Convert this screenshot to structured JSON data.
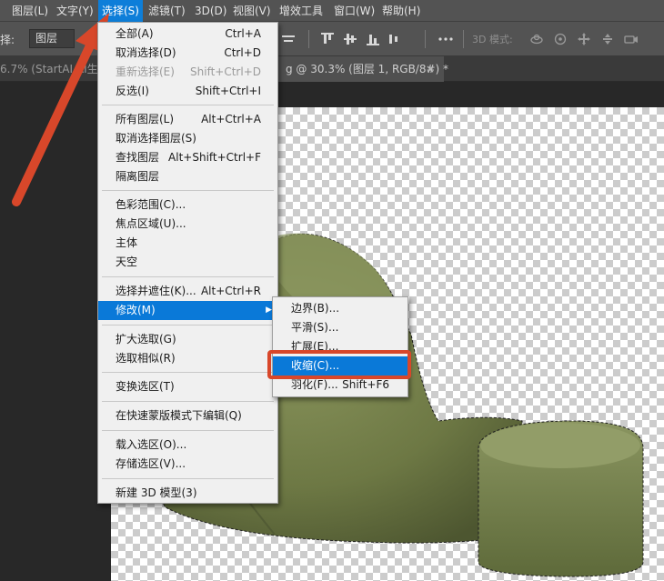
{
  "menubar": {
    "items": [
      "图层(L)",
      "文字(Y)",
      "选择(S)",
      "滤镜(T)",
      "3D(D)",
      "视图(V)",
      "增效工具",
      "窗口(W)",
      "帮助(H)"
    ]
  },
  "options": {
    "label": "择:",
    "layer_select": "图层",
    "mode_3d": "3D 模式:"
  },
  "tabs": {
    "left": "6.7% (StartAI AI生成",
    "current": "g @ 30.3% (图层 1, RGB/8#) *",
    "close": "×"
  },
  "select_menu": {
    "items": [
      {
        "label": "全部(A)",
        "shortcut": "Ctrl+A"
      },
      {
        "label": "取消选择(D)",
        "shortcut": "Ctrl+D"
      },
      {
        "label": "重新选择(E)",
        "shortcut": "Shift+Ctrl+D"
      },
      {
        "label": "反选(I)",
        "shortcut": "Shift+Ctrl+I"
      },
      {
        "label": "所有图层(L)",
        "shortcut": "Alt+Ctrl+A"
      },
      {
        "label": "取消选择图层(S)",
        "shortcut": ""
      },
      {
        "label": "查找图层",
        "shortcut": "Alt+Shift+Ctrl+F"
      },
      {
        "label": "隔离图层",
        "shortcut": ""
      },
      {
        "label": "色彩范围(C)...",
        "shortcut": ""
      },
      {
        "label": "焦点区域(U)...",
        "shortcut": ""
      },
      {
        "label": "主体",
        "shortcut": ""
      },
      {
        "label": "天空",
        "shortcut": ""
      },
      {
        "label": "选择并遮住(K)...",
        "shortcut": "Alt+Ctrl+R"
      },
      {
        "label": "修改(M)",
        "shortcut": ""
      },
      {
        "label": "扩大选取(G)",
        "shortcut": ""
      },
      {
        "label": "选取相似(R)",
        "shortcut": ""
      },
      {
        "label": "变换选区(T)",
        "shortcut": ""
      },
      {
        "label": "在快速蒙版模式下编辑(Q)",
        "shortcut": ""
      },
      {
        "label": "载入选区(O)...",
        "shortcut": ""
      },
      {
        "label": "存储选区(V)...",
        "shortcut": ""
      },
      {
        "label": "新建 3D 模型(3)",
        "shortcut": ""
      }
    ]
  },
  "modify_submenu": {
    "items": [
      {
        "label": "边界(B)...",
        "shortcut": ""
      },
      {
        "label": "平滑(S)...",
        "shortcut": ""
      },
      {
        "label": "扩展(E)...",
        "shortcut": ""
      },
      {
        "label": "收缩(C)...",
        "shortcut": ""
      },
      {
        "label": "羽化(F)...",
        "shortcut": "Shift+F6"
      }
    ]
  },
  "colors": {
    "menu_highlight": "#0a79d8",
    "annotation": "#d8472a",
    "beanbag": "#6f7a46"
  },
  "icons": [
    "align-top-icon",
    "align-vcenter-icon",
    "align-bottom-icon",
    "more-icon",
    "3d-orbit-icon",
    "3d-roll-icon",
    "3d-pan-icon",
    "3d-slide-icon",
    "3d-camera-icon",
    "submenu-arrow-icon",
    "close-icon"
  ]
}
